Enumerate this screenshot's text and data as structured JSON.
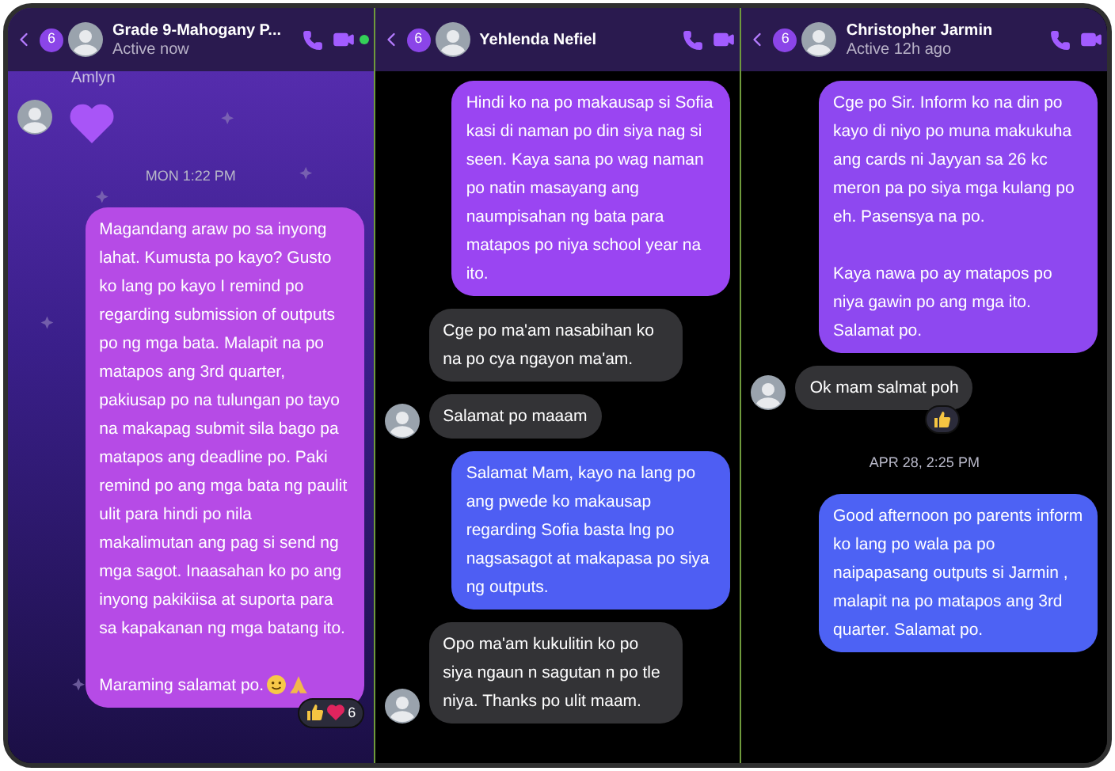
{
  "panels": [
    {
      "kind": "stars",
      "header": {
        "badge": "6",
        "title": "Grade 9-Mahogany P...",
        "subtitle": "Active now",
        "online": true
      },
      "messages": [
        {
          "kind": "sender",
          "text": "Amlyn"
        },
        {
          "kind": "heart",
          "avatar": true
        },
        {
          "kind": "timestamp",
          "text": "MON 1:22 PM"
        },
        {
          "kind": "outgoing",
          "color": "#b64be6",
          "paragraphs": [
            "Magandang araw po sa inyong lahat. Kumusta po kayo? Gusto ko lang po kayo I remind po regarding submission of outputs po ng mga bata. Malapit na po matapos ang 3rd quarter, pakiusap po na tulungan po tayo na makapag submit sila bago pa matapos ang deadline po. Paki remind po ang mga bata ng paulit ulit para hindi po nila makalimutan ang pag si send ng mga sagot.  Inaasahan ko po ang inyong pakikiisa at suporta para sa kapakanan ng mga batang ito.",
            "Maraming salamat po."
          ],
          "emoji_suffix": true,
          "reactions": {
            "items": [
              {
                "kind": "thumb"
              },
              {
                "kind": "heart"
              }
            ],
            "count": "6"
          }
        }
      ]
    },
    {
      "kind": "dark",
      "header": {
        "badge": "6",
        "title": "Yehlenda Nefiel",
        "online": false
      },
      "messages": [
        {
          "kind": "outgoing",
          "color": "#9a45f2",
          "paragraphs": [
            "Hindi ko na po makausap si Sofia kasi di naman po din siya nag si seen. Kaya sana po wag naman po natin masayang ang naumpisahan ng bata para matapos po niya school year na ito."
          ],
          "emoji_suffix": false
        },
        {
          "kind": "incoming",
          "avatar": false,
          "text": "Cge po ma'am nasabihan ko na po cya ngayon ma'am."
        },
        {
          "kind": "incoming",
          "avatar": true,
          "text": "Salamat po maaam"
        },
        {
          "kind": "outgoing",
          "color": "#4e5ef3",
          "paragraphs": [
            "Salamat Mam, kayo na lang po ang pwede ko makausap regarding Sofia basta lng po nagsasagot at makapasa po siya ng outputs."
          ],
          "emoji_suffix": false
        },
        {
          "kind": "incoming",
          "avatar": true,
          "text": "Opo ma'am kukulitin ko po siya ngaun n sagutan n po tle niya. Thanks po ulit maam."
        }
      ]
    },
    {
      "kind": "dark",
      "header": {
        "badge": "6",
        "title": "Christopher Jarmin",
        "subtitle": "Active 12h ago",
        "online": false
      },
      "messages": [
        {
          "kind": "outgoing",
          "color": "#8e48f0",
          "paragraphs": [
            "Cge po Sir. Inform ko na din po kayo di niyo po muna makukuha ang cards ni Jayyan sa 26 kc meron pa po siya mga kulang po eh. Pasensya na po.",
            "Kaya nawa po ay matapos po niya gawin po ang mga ito. Salamat po."
          ],
          "emoji_suffix": false
        },
        {
          "kind": "incoming",
          "avatar": true,
          "text": "Ok mam salmat poh",
          "reactions": {
            "items": [
              {
                "kind": "thumb"
              }
            ]
          }
        },
        {
          "kind": "timestamp",
          "text": "APR 28, 2:25 PM"
        },
        {
          "kind": "outgoing",
          "color": "#4d62f4",
          "paragraphs": [
            "Good afternoon po parents inform ko lang po wala pa po naipapasang outputs si Jarmin , malapit na po matapos ang 3rd quarter. Salamat po."
          ],
          "emoji_suffix": false
        }
      ]
    }
  ]
}
